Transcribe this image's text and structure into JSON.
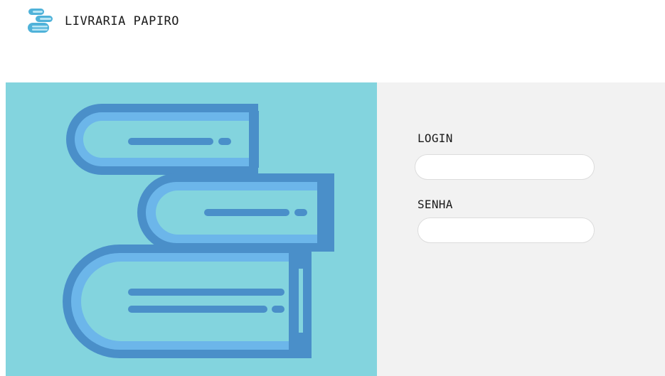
{
  "header": {
    "brand": "LIVRARIA PAPIRO",
    "logo_icon": "books-stack-icon"
  },
  "hero": {
    "illustration": "books-stack-illustration",
    "background_color": "#83d4de"
  },
  "login_form": {
    "login_label": "LOGIN",
    "login_value": "",
    "senha_label": "SENHA",
    "senha_value": ""
  },
  "colors": {
    "panel_background": "#f2f2f2",
    "book_dark": "#4a8fc9",
    "book_light": "#6cb6ea"
  }
}
